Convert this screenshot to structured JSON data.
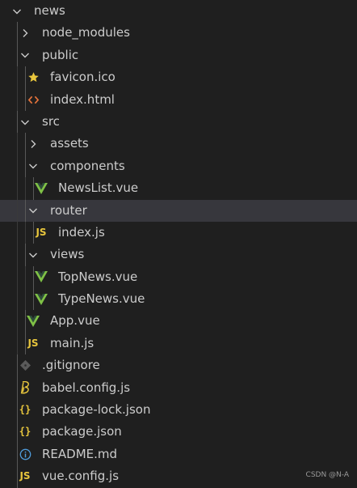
{
  "explorer": {
    "items": [
      {
        "label": "news",
        "depth": 0,
        "kind": "folder",
        "icon": "chevron-down-icon",
        "expanded": true
      },
      {
        "label": "node_modules",
        "depth": 1,
        "kind": "folder",
        "icon": "chevron-right-icon",
        "expanded": false
      },
      {
        "label": "public",
        "depth": 1,
        "kind": "folder",
        "icon": "chevron-down-icon",
        "expanded": true
      },
      {
        "label": "favicon.ico",
        "depth": 2,
        "kind": "file",
        "icon": "star-icon",
        "color": "#e8c63d"
      },
      {
        "label": "index.html",
        "depth": 2,
        "kind": "file",
        "icon": "html-icon",
        "color": "#e8743b"
      },
      {
        "label": "src",
        "depth": 1,
        "kind": "folder",
        "icon": "chevron-down-icon",
        "expanded": true
      },
      {
        "label": "assets",
        "depth": 2,
        "kind": "folder",
        "icon": "chevron-right-icon",
        "expanded": false
      },
      {
        "label": "components",
        "depth": 2,
        "kind": "folder",
        "icon": "chevron-down-icon",
        "expanded": true
      },
      {
        "label": "NewsList.vue",
        "depth": 3,
        "kind": "file",
        "icon": "vue-icon",
        "color": "#7fc146"
      },
      {
        "label": "router",
        "depth": 2,
        "kind": "folder",
        "icon": "chevron-down-icon",
        "expanded": true,
        "selected": true
      },
      {
        "label": "index.js",
        "depth": 3,
        "kind": "file",
        "icon": "js-icon",
        "icon_text": "JS",
        "color": "#e8c63d"
      },
      {
        "label": "views",
        "depth": 2,
        "kind": "folder",
        "icon": "chevron-down-icon",
        "expanded": true
      },
      {
        "label": "TopNews.vue",
        "depth": 3,
        "kind": "file",
        "icon": "vue-icon",
        "color": "#7fc146"
      },
      {
        "label": "TypeNews.vue",
        "depth": 3,
        "kind": "file",
        "icon": "vue-icon",
        "color": "#7fc146"
      },
      {
        "label": "App.vue",
        "depth": 2,
        "kind": "file",
        "icon": "vue-icon",
        "color": "#7fc146"
      },
      {
        "label": "main.js",
        "depth": 2,
        "kind": "file",
        "icon": "js-icon",
        "icon_text": "JS",
        "color": "#e8c63d"
      },
      {
        "label": ".gitignore",
        "depth": 1,
        "kind": "file",
        "icon": "git-icon",
        "color": "#3f3f3f"
      },
      {
        "label": "babel.config.js",
        "depth": 1,
        "kind": "file",
        "icon": "babel-icon",
        "color": "#e8c63d"
      },
      {
        "label": "package-lock.json",
        "depth": 1,
        "kind": "file",
        "icon": "json-icon",
        "icon_text": "{}",
        "color": "#e8c63d"
      },
      {
        "label": "package.json",
        "depth": 1,
        "kind": "file",
        "icon": "json-icon",
        "icon_text": "{}",
        "color": "#e8c63d"
      },
      {
        "label": "README.md",
        "depth": 1,
        "kind": "file",
        "icon": "info-icon",
        "color": "#4f9ad8"
      },
      {
        "label": "vue.config.js",
        "depth": 1,
        "kind": "file",
        "icon": "js-icon",
        "icon_text": "JS",
        "color": "#e8c63d"
      }
    ]
  },
  "watermark": "CSDN @N-A",
  "colors": {
    "background": "#1f1f1f",
    "selected_row": "#37373d",
    "text": "#cccccc",
    "indent_guide": "#585858"
  }
}
